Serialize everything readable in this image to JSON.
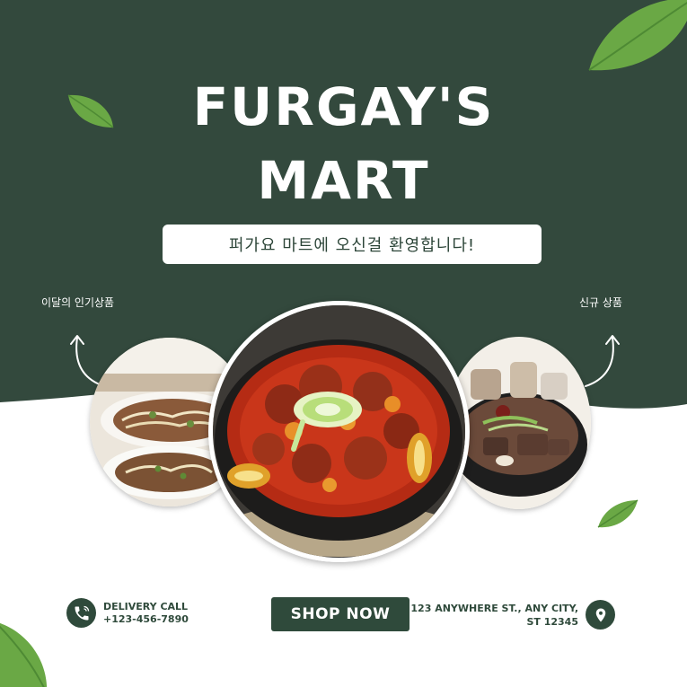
{
  "brand": {
    "title_line1": "FURGAY'S",
    "title_line2": "MART"
  },
  "welcome": "퍼가요 마트에 오신걸 환영합니다!",
  "labels": {
    "popular": "이달의 인기상품",
    "new": "신규 상품"
  },
  "images": {
    "left": "bean-sprout-stir-fry-photo",
    "center": "braised-spicy-pork-rib-stew-photo",
    "right": "beef-bone-soup-photo"
  },
  "contact": {
    "line1": "DELIVERY CALL",
    "line2": "+123-456-7890"
  },
  "cta": {
    "label": "SHOP NOW"
  },
  "address": {
    "line1": "123 ANYWHERE ST., ANY CITY,",
    "line2": "ST 12345"
  },
  "colors": {
    "primary": "#33493d",
    "white": "#ffffff",
    "leaf": "#6aa845"
  },
  "icons": {
    "phone": "phone-icon",
    "location": "location-pin-icon",
    "arrow": "curved-arrow-icon",
    "leaf": "leaf-icon"
  }
}
